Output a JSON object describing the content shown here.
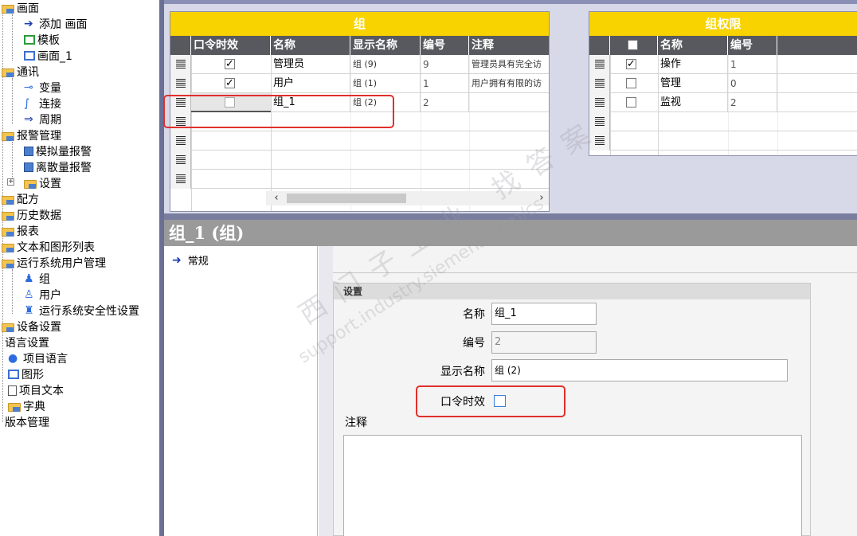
{
  "tree": {
    "items": [
      {
        "label": "画面",
        "icon": "folder-icon"
      },
      {
        "label": "添加 画面",
        "icon": "add-screen-icon"
      },
      {
        "label": "模板",
        "icon": "template-icon"
      },
      {
        "label": "画面_1",
        "icon": "screen-icon"
      },
      {
        "label": "通讯",
        "icon": "folder-icon"
      },
      {
        "label": "变量",
        "icon": "tag-icon"
      },
      {
        "label": "连接",
        "icon": "connection-icon"
      },
      {
        "label": "周期",
        "icon": "cycle-icon"
      },
      {
        "label": "报警管理",
        "icon": "folder-icon"
      },
      {
        "label": "模拟量报警",
        "icon": "analog-alarm-icon"
      },
      {
        "label": "离散量报警",
        "icon": "discrete-alarm-icon"
      },
      {
        "label": "设置",
        "icon": "settings-icon"
      },
      {
        "label": "配方",
        "icon": "recipe-icon"
      },
      {
        "label": "历史数据",
        "icon": "historical-data-icon"
      },
      {
        "label": "报表",
        "icon": "report-icon"
      },
      {
        "label": "文本和图形列表",
        "icon": "text-graphic-list-icon"
      },
      {
        "label": "运行系统用户管理",
        "icon": "user-admin-icon"
      },
      {
        "label": "组",
        "icon": "group-icon"
      },
      {
        "label": "用户",
        "icon": "user-icon"
      },
      {
        "label": "运行系统安全性设置",
        "icon": "security-icon"
      },
      {
        "label": "设备设置",
        "icon": "device-settings-icon"
      },
      {
        "label": "语言设置",
        "icon": ""
      },
      {
        "label": "项目语言",
        "icon": "language-icon"
      },
      {
        "label": "图形",
        "icon": "graphics-icon"
      },
      {
        "label": "项目文本",
        "icon": "project-text-icon"
      },
      {
        "label": "字典",
        "icon": "dictionary-icon"
      },
      {
        "label": "版本管理",
        "icon": ""
      }
    ],
    "expander": "+"
  },
  "groups_table": {
    "title": "组",
    "columns": [
      "口令时效",
      "名称",
      "显示名称",
      "编号",
      "注释"
    ],
    "rows": [
      {
        "password_aging": true,
        "name": "管理员",
        "display_name": "组 (9)",
        "number": "9",
        "comment": "管理员具有完全访"
      },
      {
        "password_aging": true,
        "name": "用户",
        "display_name": "组 (1)",
        "number": "1",
        "comment": "用户拥有有限的访"
      },
      {
        "password_aging": false,
        "name": "组_1",
        "display_name": "组 (2)",
        "number": "2",
        "comment": ""
      }
    ],
    "scroll_left": "‹",
    "scroll_right": "›"
  },
  "permissions_table": {
    "title": "组权限",
    "columns": [
      "名称",
      "编号"
    ],
    "rows": [
      {
        "checked": true,
        "name": "操作",
        "number": "1"
      },
      {
        "checked": false,
        "name": "管理",
        "number": "0"
      },
      {
        "checked": false,
        "name": "监视",
        "number": "2"
      }
    ]
  },
  "properties": {
    "title": "组_1 (组)",
    "nav_general": "常规",
    "section_title": "设置",
    "name_label": "名称",
    "name_value": "组_1",
    "number_label": "编号",
    "number_value": "2",
    "display_name_label": "显示名称",
    "display_name_value": "组 (2)",
    "password_aging_label": "口令时效",
    "password_aging_checked": false,
    "comment_label": "注释"
  },
  "watermark": {
    "text": "西门子工业 找答案",
    "url": "support.industry.siemens.com/cs"
  },
  "colors": {
    "title_bar_yellow": "#f8d300",
    "header_dark": "#57595f",
    "highlight_red": "#e0302c",
    "connector_green": "#1f8a2c",
    "property_title_gray": "#9a9a9a"
  }
}
